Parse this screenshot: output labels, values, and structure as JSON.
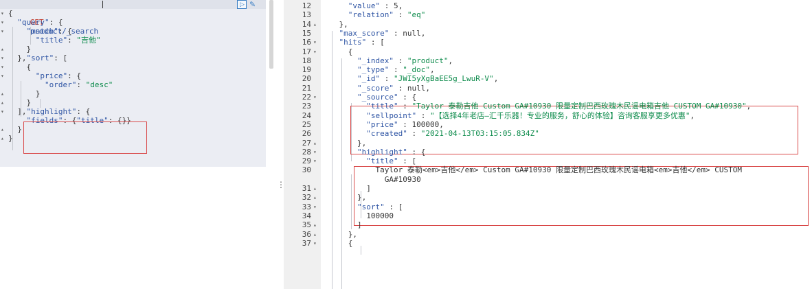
{
  "request": {
    "method": "GET",
    "path": "product/_search"
  },
  "left_lines": [
    {
      "fold": "▾",
      "text": "{"
    },
    {
      "fold": "▾",
      "text": "  \"query\": {"
    },
    {
      "fold": "▾",
      "text": "    \"match\": {"
    },
    {
      "fold": "",
      "text": "      \"title\": \"吉他\""
    },
    {
      "fold": "▴",
      "text": "    }"
    },
    {
      "fold": "▾",
      "text": "  },\"sort\": ["
    },
    {
      "fold": "▾",
      "text": "    {"
    },
    {
      "fold": "▾",
      "text": "      \"price\": {"
    },
    {
      "fold": "",
      "text": "        \"order\": \"desc\""
    },
    {
      "fold": "▴",
      "text": "      }"
    },
    {
      "fold": "▴",
      "text": "    }"
    },
    {
      "fold": "▾",
      "text": "  ],\"highlight\": {"
    },
    {
      "fold": "",
      "text": "    \"fields\": {\"title\": {}}"
    },
    {
      "fold": "▴",
      "text": "  }"
    },
    {
      "fold": "▴",
      "text": "}"
    }
  ],
  "right_lines": [
    {
      "num": "12",
      "fold": "",
      "text": "      \"value\" : 5,"
    },
    {
      "num": "13",
      "fold": "",
      "text": "      \"relation\" : \"eq\""
    },
    {
      "num": "14",
      "fold": "▴",
      "text": "    },"
    },
    {
      "num": "15",
      "fold": "",
      "text": "    \"max_score\" : null,"
    },
    {
      "num": "16",
      "fold": "▾",
      "text": "    \"hits\" : ["
    },
    {
      "num": "17",
      "fold": "▾",
      "text": "      {"
    },
    {
      "num": "18",
      "fold": "",
      "text": "        \"_index\" : \"product\","
    },
    {
      "num": "19",
      "fold": "",
      "text": "        \"_type\" : \"_doc\","
    },
    {
      "num": "20",
      "fold": "",
      "text": "        \"_id\" : \"JWI5yXgBaEE5g_LwuR-V\","
    },
    {
      "num": "21",
      "fold": "",
      "text": "        \"_score\" : null,"
    },
    {
      "num": "22",
      "fold": "▾",
      "text": "        \"_source\" : {"
    },
    {
      "num": "23",
      "fold": "",
      "text": "          \"title\" : \"Taylor 泰勒吉他 Custom GA#10930 限量定制巴西玫瑰木民谣电箱吉他 CUSTOM GA#10930\","
    },
    {
      "num": "24",
      "fold": "",
      "text": "          \"sellpoint\" : \"【选择4年老店—汇千乐器！专业的服务，舒心的体验】咨询客服享更多优惠\","
    },
    {
      "num": "25",
      "fold": "",
      "text": "          \"price\" : 100000,"
    },
    {
      "num": "26",
      "fold": "",
      "text": "          \"created\" : \"2021-04-13T03:15:05.834Z\""
    },
    {
      "num": "27",
      "fold": "▴",
      "text": "        },"
    },
    {
      "num": "28",
      "fold": "▾",
      "text": "        \"highlight\" : {"
    },
    {
      "num": "29",
      "fold": "▾",
      "text": "          \"title\" : ["
    },
    {
      "num": "30",
      "fold": "",
      "text": "            \"Taylor 泰勒<em>吉他</em> Custom GA#10930 限量定制巴西玫瑰木民谣电箱<em>吉他</em> CUSTOM"
    },
    {
      "num": "",
      "fold": "",
      "text": "              GA#10930\""
    },
    {
      "num": "31",
      "fold": "▴",
      "text": "          ]"
    },
    {
      "num": "32",
      "fold": "▴",
      "text": "        },"
    },
    {
      "num": "33",
      "fold": "▾",
      "text": "        \"sort\" : ["
    },
    {
      "num": "34",
      "fold": "",
      "text": "          100000"
    },
    {
      "num": "35",
      "fold": "▴",
      "text": "        ]"
    },
    {
      "num": "36",
      "fold": "▴",
      "text": "      },"
    },
    {
      "num": "37",
      "fold": "▾",
      "text": "      {"
    }
  ],
  "icons": {
    "play": "play-icon",
    "wrench": "wrench-icon",
    "splitter": "drag-handle-icon"
  },
  "colors": {
    "key": "#2f55a4",
    "string": "#0b8a4a",
    "highlight_box": "#d94848",
    "request_method": "#c0392b"
  }
}
